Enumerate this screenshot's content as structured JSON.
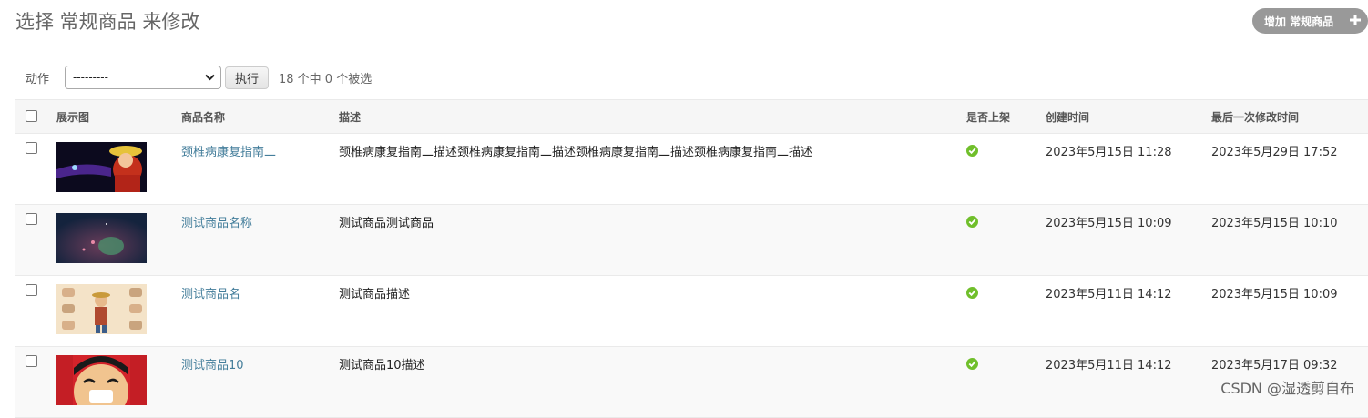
{
  "page": {
    "title": "选择 常规商品 来修改",
    "add_button": "增加 常规商品"
  },
  "actions": {
    "label": "动作",
    "selected_option": "---------",
    "go_button": "执行",
    "counter": "18 个中 0 个被选"
  },
  "table": {
    "headers": {
      "image": "展示图",
      "name": "商品名称",
      "description": "描述",
      "on_shelf": "是否上架",
      "created": "创建时间",
      "modified": "最后一次修改时间"
    },
    "rows": [
      {
        "name": "颈椎病康复指南二",
        "description": "颈椎病康复指南二描述颈椎病康复指南二描述颈椎病康复指南二描述颈椎病康复指南二描述",
        "on_shelf": true,
        "created": "2023年5月15日 11:28",
        "modified": "2023年5月29日 17:52"
      },
      {
        "name": "测试商品名称",
        "description": "测试商品测试商品",
        "on_shelf": true,
        "created": "2023年5月15日 10:09",
        "modified": "2023年5月15日 10:10"
      },
      {
        "name": "测试商品名",
        "description": "测试商品描述",
        "on_shelf": true,
        "created": "2023年5月11日 14:12",
        "modified": "2023年5月15日 10:09"
      },
      {
        "name": "测试商品10",
        "description": "测试商品10描述",
        "on_shelf": true,
        "created": "2023年5月11日 14:12",
        "modified": "2023年5月17日 09:32"
      }
    ]
  },
  "watermark": "CSDN @湿透剪自布",
  "colors": {
    "link": "#447e9b",
    "success": "#70bf2b",
    "button_gray": "#999999"
  },
  "icons": [
    "plus-icon",
    "chevron-down-icon",
    "check-circle-icon"
  ]
}
